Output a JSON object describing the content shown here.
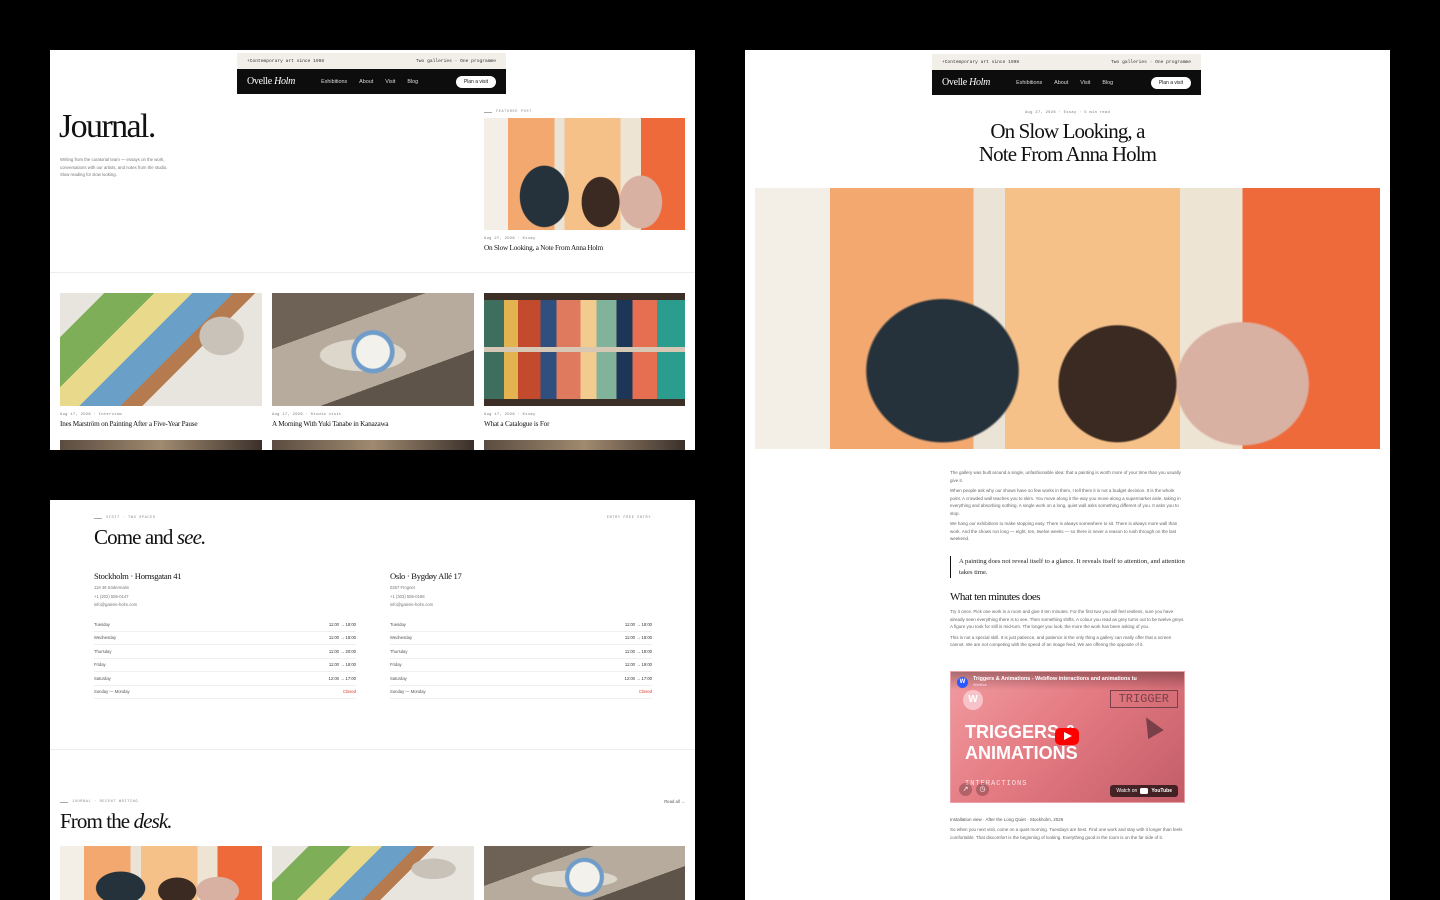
{
  "header": {
    "strip_left": "+Contemporary art since 1998",
    "strip_right": "Two galleries · One programme",
    "logo_a": "Ovelle ",
    "logo_b": "Holm",
    "nav": [
      "Exhibitions",
      "About",
      "Visit",
      "Blog"
    ],
    "cta": "Plan a visit"
  },
  "journal": {
    "title": "Journal.",
    "intro": "Writing from the curatorial team — essays on the work, conversations with our artists, and notes from the studio. Slow reading for slow looking.",
    "featured_eyebrow": "FEATURED POST",
    "featured_meta": "Aug 27, 2026 · Essay",
    "featured_title": "On Slow Looking, a Note From Anna Holm",
    "cards": [
      {
        "meta": "Aug 17, 2026 · Interview",
        "title": "Ines Marström on Painting After a Five-Year Pause"
      },
      {
        "meta": "Aug 17, 2026 · Studio visit",
        "title": "A Morning With Yuki Tanabe in Kanazawa"
      },
      {
        "meta": "Aug 17, 2026 · Essay",
        "title": "What a Catalogue is For"
      }
    ]
  },
  "visit": {
    "eyebrow": "VISIT · TWO SPACES",
    "eyebrow_right": "ENTRY FREE ENTRY",
    "title_a": "Come and ",
    "title_b": "see.",
    "locations": [
      {
        "name": "Stockholm · Hornsgatan 41",
        "lines": [
          "118 49 Södermalm",
          "+1 (202) 555-0147",
          "info@galerie-holm.com"
        ],
        "hours": [
          {
            "day": "Tuesday",
            "time": "11:00 → 18:00"
          },
          {
            "day": "Wednesday",
            "time": "11:00 → 18:00"
          },
          {
            "day": "Thursday",
            "time": "11:00 → 20:00"
          },
          {
            "day": "Friday",
            "time": "11:00 → 18:00"
          },
          {
            "day": "Saturday",
            "time": "12:00 → 17:00"
          },
          {
            "day": "Sunday — Monday",
            "time": "Closed"
          }
        ]
      },
      {
        "name": "Oslo · Bygdøy Allé 17",
        "lines": [
          "0257 Frogner",
          "+1 (303) 555-0198",
          "info@galerie-holm.com"
        ],
        "hours": [
          {
            "day": "Tuesday",
            "time": "11:00 → 18:00"
          },
          {
            "day": "Wednesday",
            "time": "11:00 → 18:00"
          },
          {
            "day": "Thursday",
            "time": "11:00 → 18:00"
          },
          {
            "day": "Friday",
            "time": "11:00 → 19:00"
          },
          {
            "day": "Saturday",
            "time": "12:00 → 17:00"
          },
          {
            "day": "Sunday — Monday",
            "time": "Closed"
          }
        ]
      }
    ],
    "desk_eyebrow": "JOURNAL · RECENT WRITING",
    "desk_link": "Read all →",
    "desk_title_a": "From the ",
    "desk_title_b": "desk."
  },
  "article": {
    "meta": "Aug 27, 2026 · Essay · 5 min read",
    "title_line1": "On Slow Looking, a",
    "title_line2": "Note From Anna Holm",
    "p1": "The gallery was built around a single, unfashionable idea: that a painting is worth more of your time than you usually give it.",
    "p2": "When people ask why our shows have so few works in them, I tell them it is not a budget decision. It is the whole point. A crowded wall teaches you to skim. You move along it the way you move along a supermarket aisle, taking in everything and absorbing nothing. A single work on a long, quiet wall asks something different of you. It asks you to stop.",
    "p3": "We hang our exhibitions to make stopping easy. There is always somewhere to sit. There is always more wall than work. And the shows run long — eight, ten, twelve weeks — so there is never a reason to rush through on the last weekend.",
    "quote": "A painting does not reveal itself to a glance. It reveals itself to attention, and attention takes time.",
    "h2": "What ten minutes does",
    "p4": "Try it once. Pick one work in a room and give it ten minutes. For the first two you will feel restless, sure you have already seen everything there is to see. Then something shifts. A colour you read as grey turns out to be twelve greys. A figure you took for still is mid-turn. The longer you look, the more the work has been asking of you.",
    "p5": "This is not a special skill. It is just patience, and patience is the only thing a gallery can really offer that a screen cannot. We are not competing with the speed of an image feed. We are offering the opposite of it.",
    "video": {
      "title": "Triggers & Animations - Webflow interactions and animations tu",
      "channel": "Webflow",
      "line1": "TRIGGERS &",
      "line2": "ANIMATIONS",
      "sub": "INTERACTIONS",
      "badge": "TRIGGER",
      "watch": "Watch on",
      "yt": "YouTube"
    },
    "caption": "Installation view · After the Long Quiet · Stockholm, 2026",
    "p6": "So when you next visit, come on a quiet morning. Tuesdays are best. Find one work and stay with it longer than feels comfortable. That discomfort is the beginning of looking. Everything good in the room is on the far side of it."
  }
}
